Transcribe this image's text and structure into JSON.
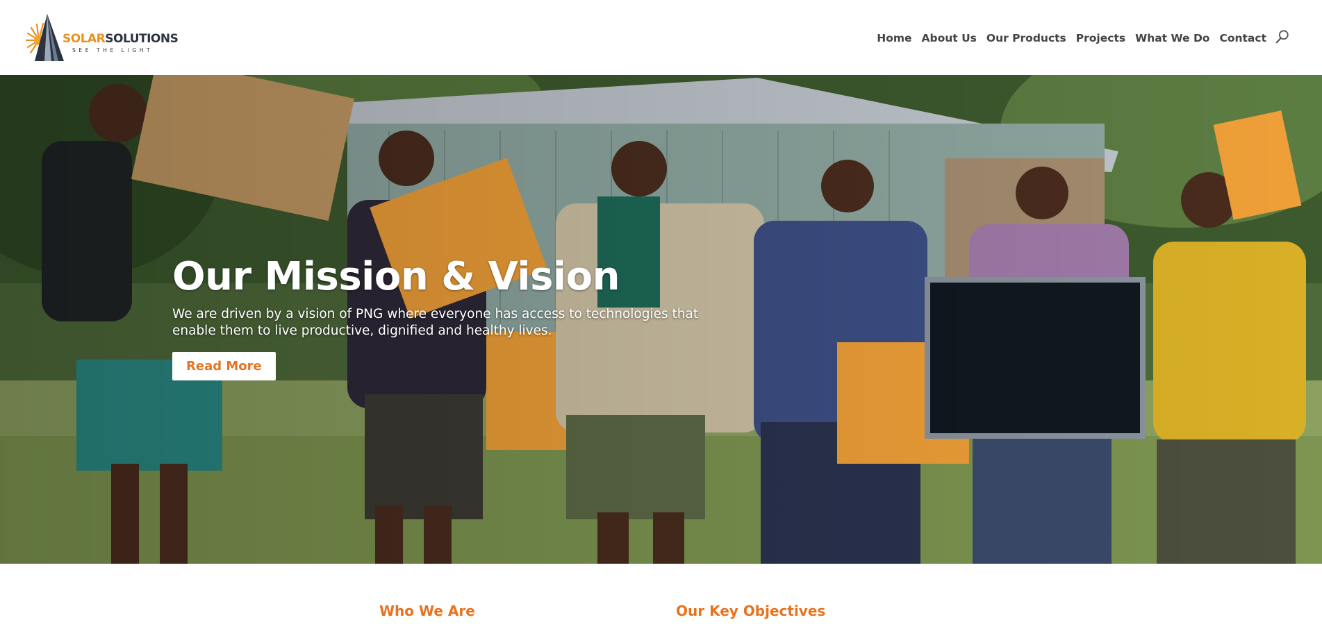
{
  "brand": {
    "name_part1": "SOLAR",
    "name_part2": "SOLUTIONS",
    "tagline": "SEE THE LIGHT",
    "accent": "#e8911e",
    "dark": "#2b3340"
  },
  "nav": {
    "items": [
      {
        "label": "Home"
      },
      {
        "label": "About Us"
      },
      {
        "label": "Our Products"
      },
      {
        "label": "Projects"
      },
      {
        "label": "What We Do"
      },
      {
        "label": "Contact"
      }
    ],
    "search_icon": "search-icon"
  },
  "hero": {
    "title": "Our Mission & Vision",
    "text": "We are driven by a vision of PNG where everyone has access to technologies that enable them to live productive, dignified and healthy lives.",
    "button_label": "Read More",
    "button_color": "#e8731e"
  },
  "sections": {
    "who_we_are": "Who We Are",
    "key_objectives": "Our Key Objectives"
  }
}
